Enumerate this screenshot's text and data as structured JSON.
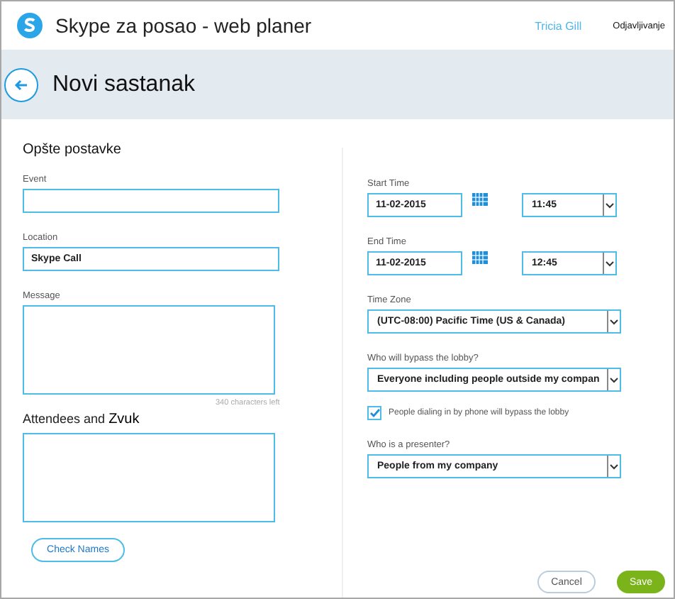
{
  "app": {
    "title": "Skype za posao - web planer",
    "user": "Tricia Gill",
    "sign_out": "Odjavljivanje"
  },
  "page": {
    "title": "Novi sastanak"
  },
  "section_title": "Opšte postavke",
  "event": {
    "label": "Event"
  },
  "location": {
    "label": "Location",
    "value": "Skype Call"
  },
  "message": {
    "label": "Message",
    "counter": "340 characters left"
  },
  "attendees": {
    "label": "Attendees and ",
    "label_extra": "Zvuk"
  },
  "check_names": "Check Names",
  "start": {
    "label": "Start Time",
    "date": "11-02-2015",
    "time": "11:45"
  },
  "end": {
    "label": "End Time",
    "date": "11-02-2015",
    "time": "12:45"
  },
  "time_zone": {
    "label": "Time Zone",
    "value": "(UTC-08:00) Pacific Time (US & Canada)"
  },
  "lobby": {
    "label": "Who will bypass the lobby?",
    "value": "Everyone including people outside my compan"
  },
  "phone_bypass": {
    "label": "People dialing in by phone will bypass the lobby",
    "checked": true
  },
  "presenter": {
    "label": "Who is a presenter?",
    "value": "People from my company"
  },
  "buttons": {
    "cancel": "Cancel",
    "save": "Save"
  }
}
